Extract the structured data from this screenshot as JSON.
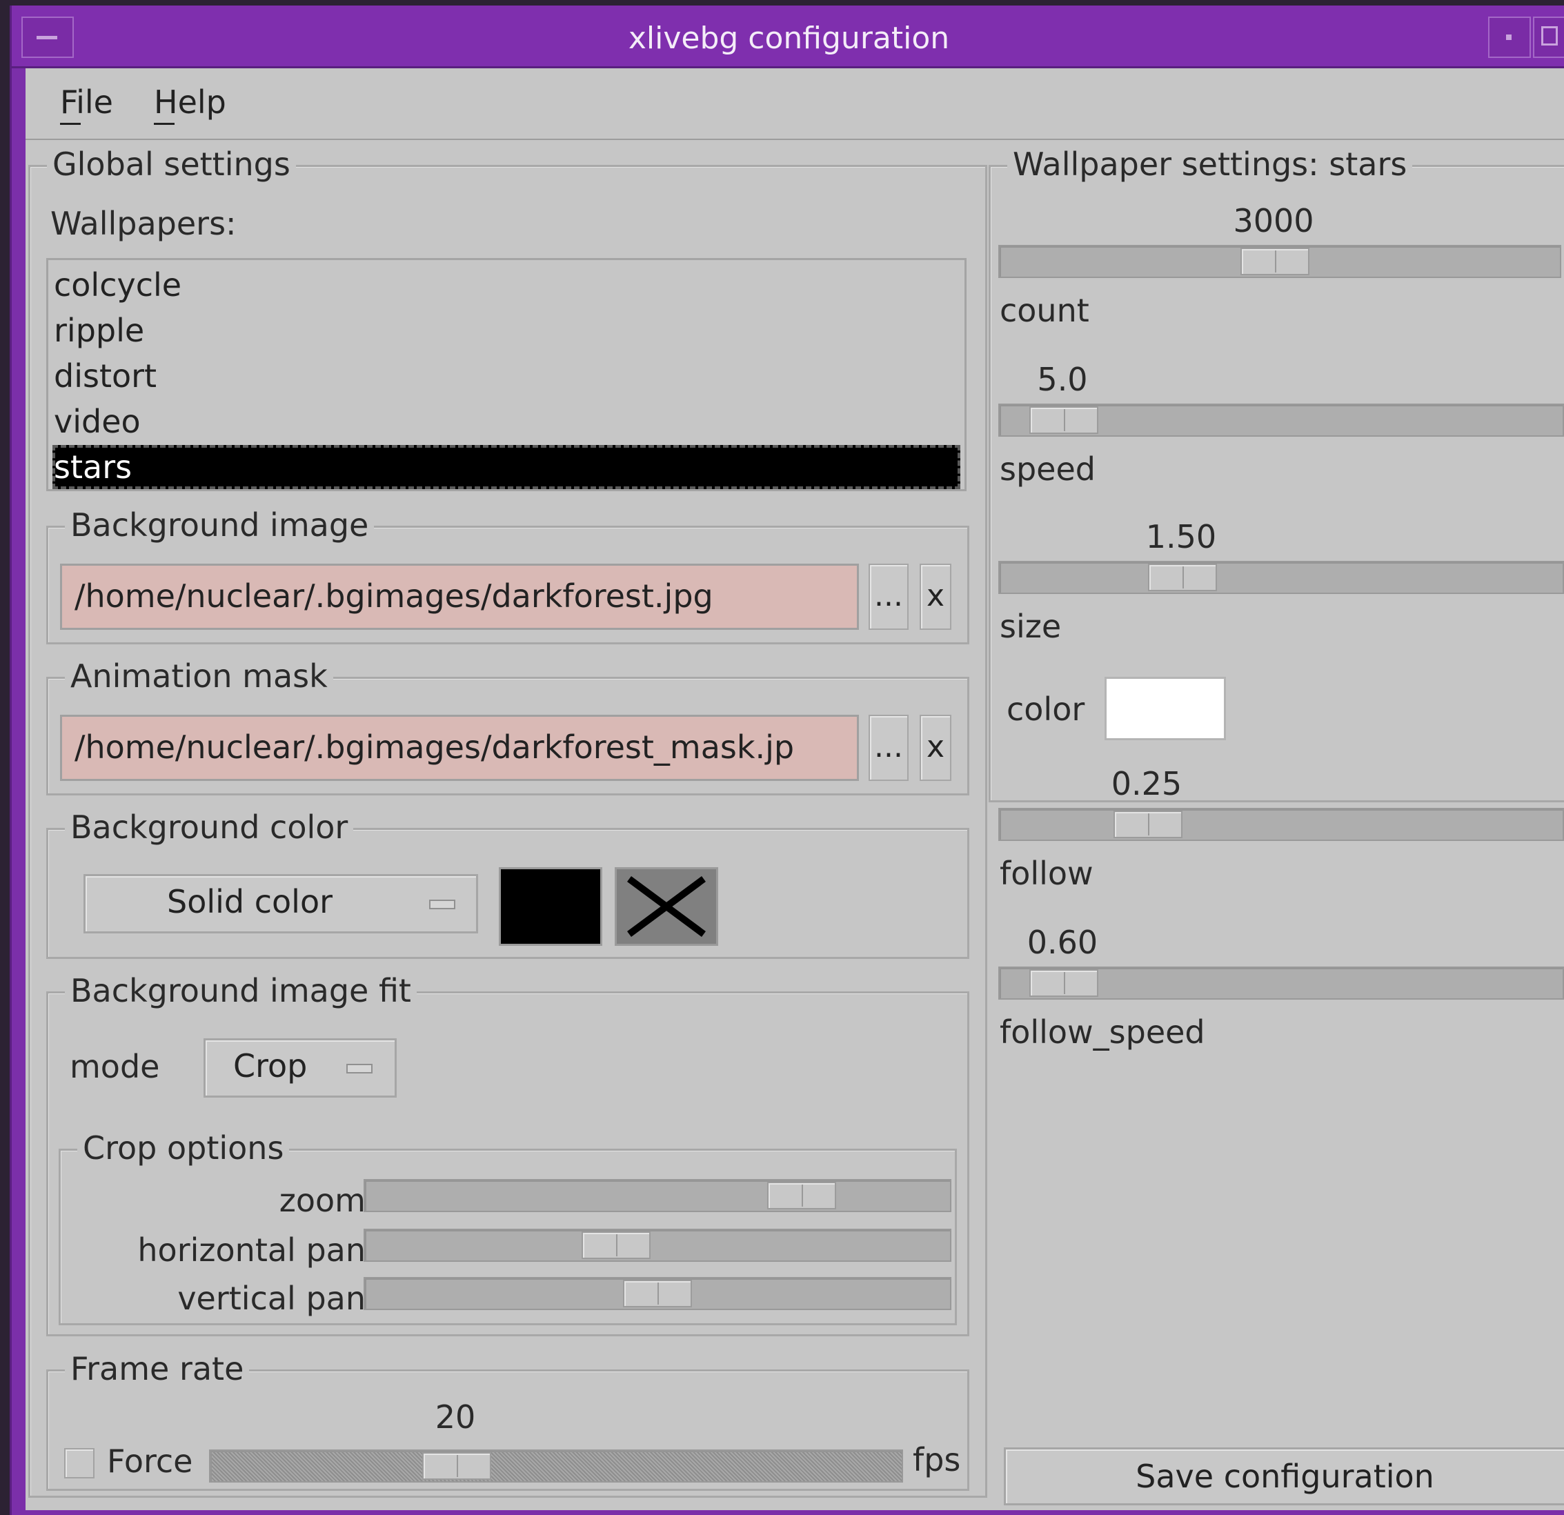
{
  "window": {
    "title": "xlivebg configuration"
  },
  "menubar": {
    "file": "File",
    "help": "Help"
  },
  "global": {
    "legend": "Global settings",
    "wallpapers_label": "Wallpapers:",
    "wallpapers": [
      "colcycle",
      "ripple",
      "distort",
      "video",
      "stars"
    ],
    "selected_wallpaper": "stars",
    "bg_image": {
      "legend": "Background image",
      "value": "/home/nuclear/.bgimages/darkforest.jpg",
      "browse": "...",
      "clear": "x"
    },
    "anim_mask": {
      "legend": "Animation mask",
      "value": "/home/nuclear/.bgimages/darkforest_mask.jp",
      "browse": "...",
      "clear": "x"
    },
    "bg_color": {
      "legend": "Background color",
      "mode": "Solid color",
      "color1": "#000000",
      "color2": "#808080"
    },
    "bg_fit": {
      "legend": "Background image fit",
      "mode_label": "mode",
      "mode_value": "Crop",
      "crop": {
        "legend": "Crop options",
        "zoom_label": "zoom",
        "zoom": 0.78,
        "hpan_label": "horizontal pan",
        "hpan": 0.42,
        "vpan_label": "vertical pan",
        "vpan": 0.5
      }
    },
    "frame_rate": {
      "legend": "Frame rate",
      "force_label": "Force",
      "force": false,
      "fps": "20",
      "fps_unit": "fps",
      "level": 0.34
    }
  },
  "wallpaper": {
    "legend": "Wallpaper settings: stars",
    "count": {
      "label": "count",
      "value": "3000",
      "level": 0.49
    },
    "speed": {
      "label": "speed",
      "value": "5.0",
      "level": 0.06
    },
    "size": {
      "label": "size",
      "value": "1.50",
      "level": 0.3
    },
    "color": {
      "label": "color",
      "value": "#ffffff"
    },
    "follow": {
      "label": "follow",
      "value": "0.25",
      "level": 0.23
    },
    "follow_speed": {
      "label": "follow_speed",
      "value": "0.60",
      "level": 0.06
    },
    "save": "Save configuration"
  }
}
